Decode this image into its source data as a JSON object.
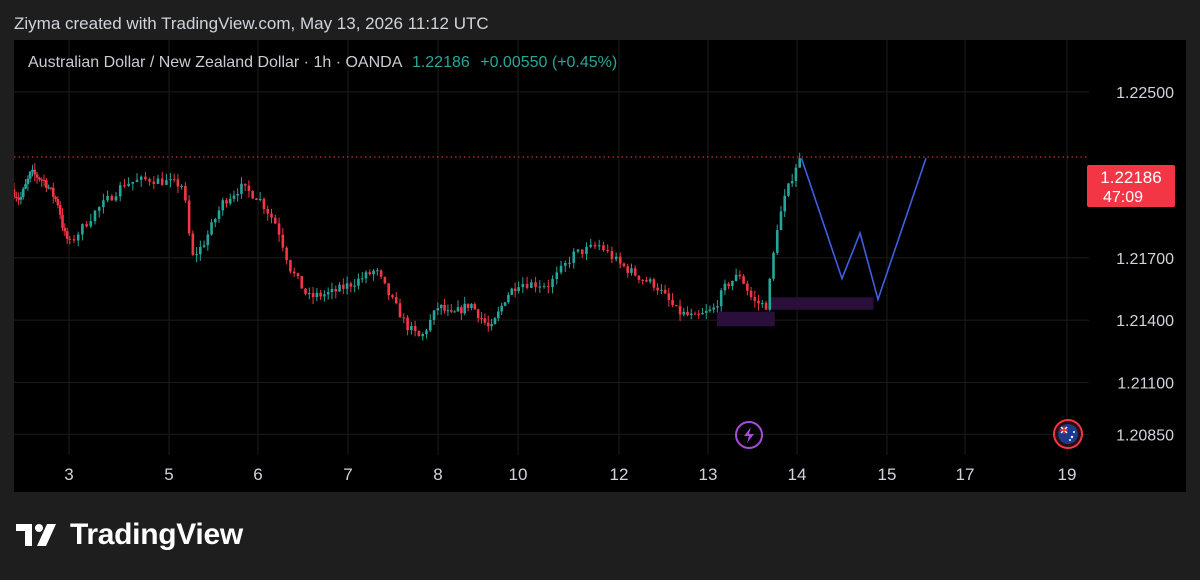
{
  "header": {
    "created_by": "Ziyma created with TradingView.com, May 13, 2026 11:12 UTC"
  },
  "legend": {
    "symbol_title": "Australian Dollar / New Zealand Dollar · 1h · OANDA",
    "last_price": "1.22186",
    "change": "+0.00550 (+0.45%)"
  },
  "price_tag": {
    "price": "1.22186",
    "countdown": "47:09"
  },
  "footer": {
    "brand": "TradingView"
  },
  "colors": {
    "up": "#26a69a",
    "down": "#f23645",
    "projection": "#3f5fe6",
    "zone": "#2a0f3a",
    "price_line": "#f23645",
    "tag_bg": "#f23645"
  },
  "icons": {
    "event": "lightning-icon",
    "flag": "australia-flag-icon"
  },
  "chart_data": {
    "type": "candlestick",
    "symbol": "AUDNZD",
    "interval": "1h",
    "ylim": [
      1.2075,
      1.2275
    ],
    "yticks": [
      1.225,
      1.217,
      1.214,
      1.211,
      1.2085
    ],
    "ytick_labels": [
      "1.22500",
      "1.21700",
      "1.21400",
      "1.21100",
      "1.20850"
    ],
    "x_ticks": [
      {
        "label": "3",
        "day": 3
      },
      {
        "label": "5",
        "day": 5
      },
      {
        "label": "6",
        "day": 6
      },
      {
        "label": "7",
        "day": 7
      },
      {
        "label": "8",
        "day": 8
      },
      {
        "label": "10",
        "day": 10
      },
      {
        "label": "12",
        "day": 12
      },
      {
        "label": "13",
        "day": 13
      },
      {
        "label": "14",
        "day": 14
      },
      {
        "label": "15",
        "day": 15
      },
      {
        "label": "17",
        "day": 17
      },
      {
        "label": "19",
        "day": 19
      }
    ],
    "price_anchors": [
      [
        0,
        1.2203
      ],
      [
        0.15,
        1.2198
      ],
      [
        0.35,
        1.2211
      ],
      [
        0.6,
        1.2207
      ],
      [
        0.85,
        1.2196
      ],
      [
        0.95,
        1.2182
      ],
      [
        1.05,
        1.2177
      ],
      [
        1.3,
        1.2192
      ],
      [
        1.6,
        1.2206
      ],
      [
        1.85,
        1.2208
      ],
      [
        2.2,
        1.2205
      ],
      [
        2.3,
        1.217
      ],
      [
        2.42,
        1.2176
      ],
      [
        2.65,
        1.2197
      ],
      [
        2.85,
        1.2204
      ],
      [
        3.05,
        1.2199
      ],
      [
        3.25,
        1.2186
      ],
      [
        3.4,
        1.2165
      ],
      [
        3.6,
        1.2151
      ],
      [
        3.85,
        1.2153
      ],
      [
        4.1,
        1.2158
      ],
      [
        4.35,
        1.2164
      ],
      [
        4.5,
        1.2152
      ],
      [
        4.7,
        1.2137
      ],
      [
        4.85,
        1.2131
      ],
      [
        5.05,
        1.2147
      ],
      [
        5.2,
        1.2142
      ],
      [
        5.45,
        1.2148
      ],
      [
        5.7,
        1.2135
      ],
      [
        5.9,
        1.2152
      ],
      [
        6.05,
        1.2158
      ],
      [
        6.35,
        1.2157
      ],
      [
        6.6,
        1.2172
      ],
      [
        6.85,
        1.2176
      ],
      [
        7.05,
        1.2167
      ],
      [
        7.3,
        1.216
      ],
      [
        7.45,
        1.2157
      ],
      [
        7.7,
        1.2144
      ],
      [
        7.9,
        1.2141
      ],
      [
        8.1,
        1.2145
      ],
      [
        8.25,
        1.2157
      ],
      [
        8.4,
        1.2162
      ],
      [
        8.55,
        1.2149
      ],
      [
        8.7,
        1.2147
      ],
      [
        8.82,
        1.2185
      ],
      [
        8.9,
        1.2198
      ],
      [
        9.05,
        1.2217
      ]
    ],
    "projection_path": [
      [
        9.05,
        1.2218
      ],
      [
        9.5,
        1.216
      ],
      [
        9.7,
        1.2182
      ],
      [
        9.9,
        1.215
      ],
      [
        10.5,
        1.2218
      ]
    ],
    "zones": [
      {
        "x0": 8.1,
        "x1": 8.75,
        "y0": 1.2144,
        "y1": 1.2137
      },
      {
        "x0": 8.7,
        "x1": 9.85,
        "y0": 1.2151,
        "y1": 1.2145
      }
    ],
    "last_price": 1.22186
  }
}
